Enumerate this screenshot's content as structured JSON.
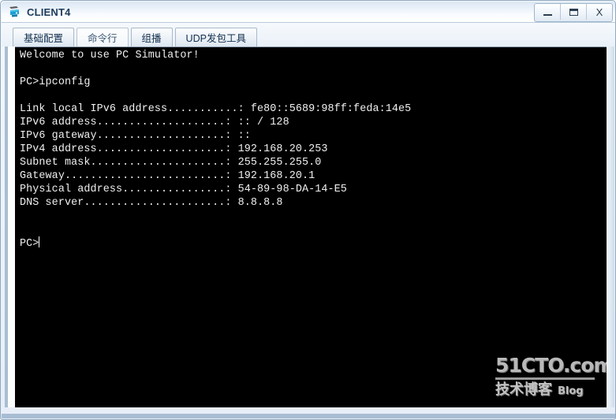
{
  "window": {
    "title": "CLIENT4",
    "icon": "pc-device-icon",
    "buttons": [
      {
        "name": "minimize-button",
        "label": "—",
        "glyph": "minimize"
      },
      {
        "name": "maximize-button",
        "label": "□",
        "glyph": "maximize"
      },
      {
        "name": "close-button",
        "label": "X",
        "glyph": "close"
      }
    ]
  },
  "tabs": [
    {
      "label": "基础配置",
      "active": false
    },
    {
      "label": "命令行",
      "active": true
    },
    {
      "label": "组播",
      "active": false
    },
    {
      "label": "UDP发包工具",
      "active": false
    }
  ],
  "terminal": {
    "background": "#000000",
    "foreground": "#f0f0f0",
    "welcome": "Welcome to use PC Simulator!",
    "blank1": "",
    "command_line": "PC>ipconfig",
    "blank2": "",
    "output": "Link local IPv6 address...........: fe80::5689:98ff:feda:14e5\nIPv6 address....................: :: / 128\nIPv6 gateway....................: ::\nIPv4 address....................: 192.168.20.253\nSubnet mask.....................: 255.255.255.0\nGateway.........................: 192.168.20.1\nPhysical address................: 54-89-98-DA-14-E5\nDNS server......................: 8.8.8.8",
    "blank3": "",
    "prompt": "PC>",
    "fields": [
      {
        "label": "Link local IPv6 address",
        "value": "fe80::5689:98ff:feda:14e5"
      },
      {
        "label": "IPv6 address",
        "value": ":: / 128"
      },
      {
        "label": "IPv6 gateway",
        "value": "::"
      },
      {
        "label": "IPv4 address",
        "value": "192.168.20.253"
      },
      {
        "label": "Subnet mask",
        "value": "255.255.255.0"
      },
      {
        "label": "Gateway",
        "value": "192.168.20.1"
      },
      {
        "label": "Physical address",
        "value": "54-89-98-DA-14-E5"
      },
      {
        "label": "DNS server",
        "value": "8.8.8.8"
      }
    ]
  },
  "watermark": {
    "main": "51CTO.com",
    "sub_cn": "技术博客",
    "sub_en": "Blog"
  }
}
